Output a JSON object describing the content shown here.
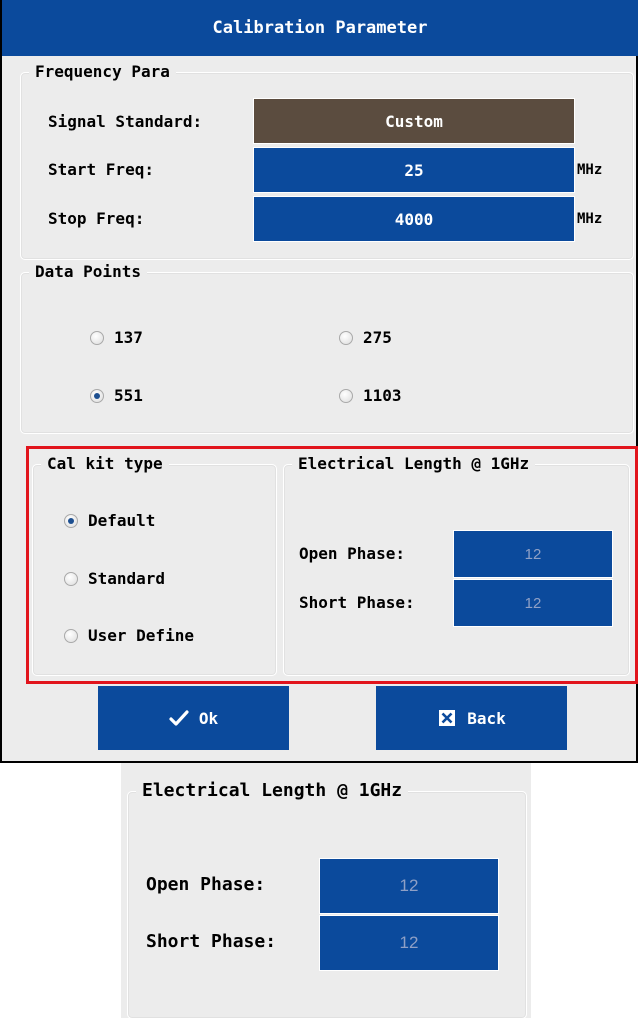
{
  "dialog": {
    "title": "Calibration Parameter",
    "frequency": {
      "legend": "Frequency Para",
      "signal_standard_label": "Signal Standard:",
      "signal_standard_value": "Custom",
      "start_label": "Start Freq:",
      "start_value": "25",
      "start_unit": "MHz",
      "stop_label": "Stop Freq:",
      "stop_value": "4000",
      "stop_unit": "MHz"
    },
    "data_points": {
      "legend": "Data Points",
      "options": [
        "137",
        "275",
        "551",
        "1103"
      ],
      "selected": "551"
    },
    "cal_kit": {
      "legend": "Cal kit type",
      "options": [
        "Default",
        "Standard",
        "User Define"
      ],
      "selected": "Default"
    },
    "electrical_length": {
      "legend": "Electrical Length @ 1GHz",
      "open_label": "Open Phase:",
      "open_value": "12",
      "short_label": "Short Phase:",
      "short_value": "12"
    },
    "buttons": {
      "ok_label": "Ok",
      "back_label": "Back"
    }
  },
  "zoom": {
    "legend": "Electrical Length @ 1GHz",
    "open_label": "Open Phase:",
    "open_value": "12",
    "short_label": "Short Phase:",
    "short_value": "12"
  },
  "colors": {
    "title_bar": "#0b4a9c",
    "field_blue": "#0b4a9c",
    "field_brown": "#5b4c3f",
    "highlight": "#e1141c",
    "panel_bg": "#ececec"
  }
}
